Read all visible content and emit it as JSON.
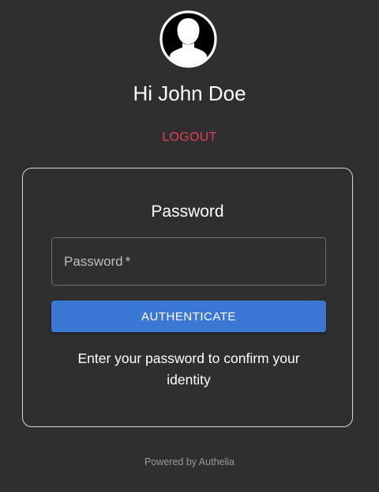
{
  "header": {
    "avatar_icon": "user-avatar-icon",
    "greeting": "Hi John Doe",
    "logout_label": "LOGOUT"
  },
  "card": {
    "title": "Password",
    "password_field": {
      "label": "Password",
      "required_marker": "*",
      "value": ""
    },
    "authenticate_label": "AUTHENTICATE",
    "hint": "Enter your password to confirm your identity"
  },
  "footer": {
    "powered_by": "Powered by Authelia"
  },
  "colors": {
    "background": "#2f2f2f",
    "text": "#ffffff",
    "logout": "#e53e5e",
    "button": "#3b77d4",
    "button_text": "#ffffff",
    "field_label": "#bdbdbd",
    "footer_text": "#9a9a9a"
  }
}
